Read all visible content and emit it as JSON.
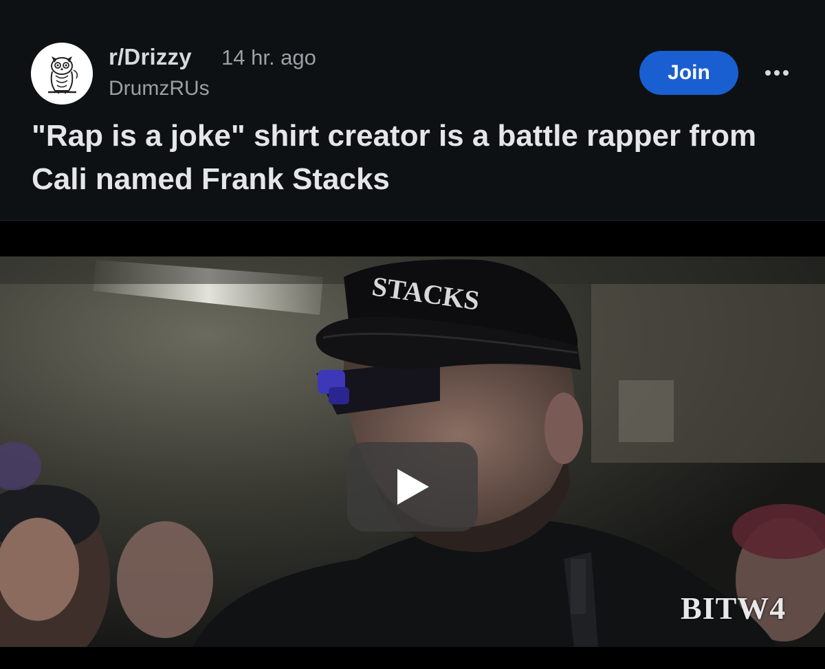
{
  "post": {
    "subreddit": "r/Drizzy",
    "time": "14 hr. ago",
    "author": "DrumzRUs",
    "title": "\"Rap is a joke\" shirt creator is a battle rapper from Cali named Frank Stacks",
    "join_label": "Join",
    "avatar_icon": "owl-icon",
    "more_icon": "more-options-icon"
  },
  "media": {
    "cap_text": "STACKS",
    "watermark": "BITW4",
    "play_icon": "play-icon"
  },
  "colors": {
    "header_bg": "#0e1113",
    "join_button": "#1a5fd1"
  }
}
